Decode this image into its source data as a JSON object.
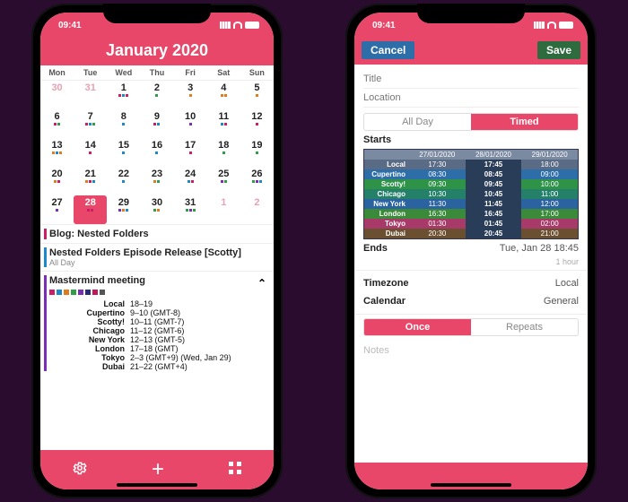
{
  "status_time": "09:41",
  "left": {
    "title": "January 2020",
    "dow": [
      "Mon",
      "Tue",
      "Wed",
      "Thu",
      "Fri",
      "Sat",
      "Sun"
    ],
    "weeks": [
      [
        {
          "n": "30",
          "dim": true
        },
        {
          "n": "31",
          "dim": true
        },
        {
          "n": "1"
        },
        {
          "n": "2"
        },
        {
          "n": "3"
        },
        {
          "n": "4"
        },
        {
          "n": "5"
        }
      ],
      [
        {
          "n": "6"
        },
        {
          "n": "7"
        },
        {
          "n": "8"
        },
        {
          "n": "9"
        },
        {
          "n": "10"
        },
        {
          "n": "11"
        },
        {
          "n": "12"
        }
      ],
      [
        {
          "n": "13"
        },
        {
          "n": "14"
        },
        {
          "n": "15"
        },
        {
          "n": "16"
        },
        {
          "n": "17"
        },
        {
          "n": "18"
        },
        {
          "n": "19"
        }
      ],
      [
        {
          "n": "20"
        },
        {
          "n": "21"
        },
        {
          "n": "22"
        },
        {
          "n": "23"
        },
        {
          "n": "24"
        },
        {
          "n": "25"
        },
        {
          "n": "26"
        }
      ],
      [
        {
          "n": "27"
        },
        {
          "n": "28",
          "today": true
        },
        {
          "n": "29"
        },
        {
          "n": "30"
        },
        {
          "n": "31"
        },
        {
          "n": "1",
          "dim": true
        },
        {
          "n": "2",
          "dim": true
        }
      ]
    ],
    "events": [
      {
        "color": "#cc1e66",
        "title": "Blog: Nested Folders",
        "sub": ""
      },
      {
        "color": "#1e88cc",
        "title": "Nested Folders Episode Release [Scotty]",
        "sub": "All Day"
      },
      {
        "color": "#7a2eb8",
        "title": "Mastermind meeting",
        "sub": "",
        "expanded": true,
        "squares": [
          "#cc1e66",
          "#1e88cc",
          "#e07b1e",
          "#2e9e4a",
          "#7a2eb8",
          "#2a2a7a",
          "#c2185b",
          "#555"
        ],
        "tz": [
          {
            "city": "Local",
            "time": "18–19"
          },
          {
            "city": "Cupertino",
            "time": "9–10 (GMT-8)"
          },
          {
            "city": "Scotty!",
            "time": "10–11 (GMT-7)"
          },
          {
            "city": "Chicago",
            "time": "11–12 (GMT-6)"
          },
          {
            "city": "New York",
            "time": "12–13 (GMT-5)"
          },
          {
            "city": "London",
            "time": "17–18 (GMT)"
          },
          {
            "city": "Tokyo",
            "time": "2–3 (GMT+9) (Wed, Jan 29)"
          },
          {
            "city": "Dubai",
            "time": "21–22 (GMT+4)"
          }
        ]
      }
    ]
  },
  "right": {
    "cancel": "Cancel",
    "save": "Save",
    "title_ph": "Title",
    "loc_ph": "Location",
    "seg_allday": "All Day",
    "seg_timed": "Timed",
    "starts_label": "Starts",
    "tz_dates": [
      "27/01/2020",
      "28/01/2020",
      "29/01/2020"
    ],
    "tz_rows": [
      {
        "city": "Local",
        "c": "#5a6b85",
        "a": "17:30",
        "b": "17:45",
        "d": "18:00"
      },
      {
        "city": "Cupertino",
        "c": "#2d6da8",
        "a": "08:30",
        "b": "08:45",
        "d": "09:00"
      },
      {
        "city": "Scotty!",
        "c": "#2e9247",
        "a": "09:30",
        "b": "09:45",
        "d": "10:00"
      },
      {
        "city": "Chicago",
        "c": "#25806a",
        "a": "10:30",
        "b": "10:45",
        "d": "11:00"
      },
      {
        "city": "New York",
        "c": "#2a63a0",
        "a": "11:30",
        "b": "11:45",
        "d": "12:00"
      },
      {
        "city": "London",
        "c": "#3a8a3a",
        "a": "16:30",
        "b": "16:45",
        "d": "17:00"
      },
      {
        "city": "Tokyo",
        "c": "#a83a6a",
        "a": "01:30",
        "b": "01:45",
        "d": "02:00"
      },
      {
        "city": "Dubai",
        "c": "#6a5030",
        "a": "20:30",
        "b": "20:45",
        "d": "21:00"
      }
    ],
    "ends_label": "Ends",
    "ends_val": "Tue, Jan 28 18:45",
    "duration": "1 hour",
    "tz_label": "Timezone",
    "tz_val": "Local",
    "cal_label": "Calendar",
    "cal_val": "General",
    "seg_once": "Once",
    "seg_repeats": "Repeats",
    "notes_ph": "Notes"
  }
}
